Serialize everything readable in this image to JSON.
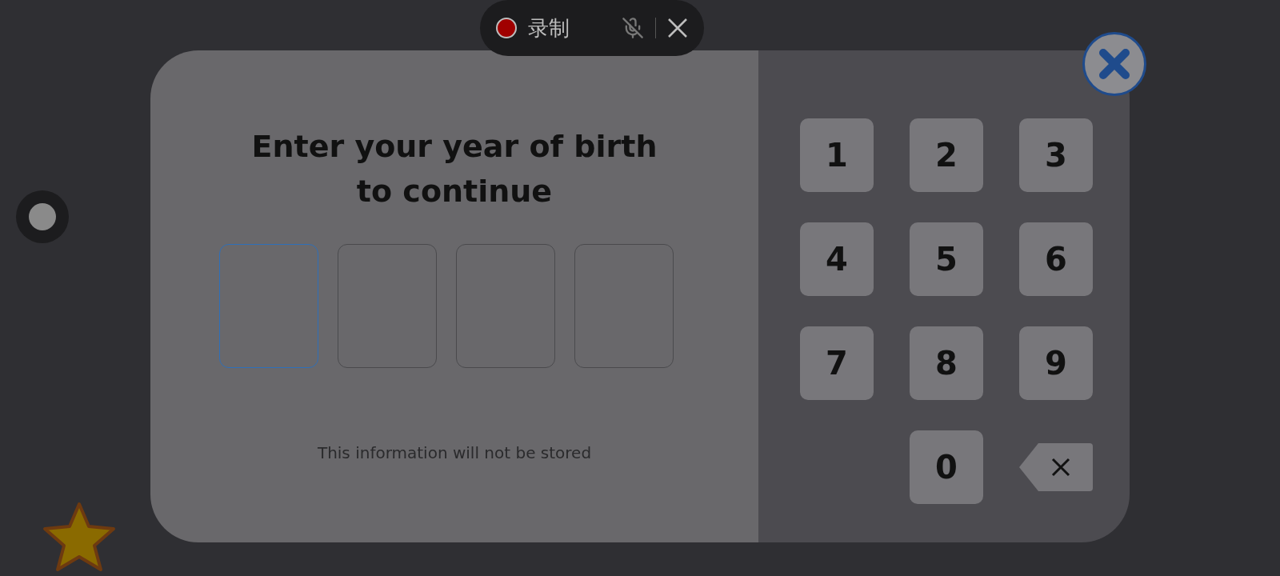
{
  "recorder": {
    "recording": true,
    "label": "录制",
    "mic_muted": true
  },
  "dialog": {
    "title": "Enter your year of birth to continue",
    "digits": [
      {
        "selected": true
      },
      {
        "selected": false
      },
      {
        "selected": false
      },
      {
        "selected": false
      }
    ],
    "note": "This information will not be stored",
    "keys": [
      {
        "kind": "digit",
        "label": "1"
      },
      {
        "kind": "digit",
        "label": "2"
      },
      {
        "kind": "digit",
        "label": "3"
      },
      {
        "kind": "digit",
        "label": "4"
      },
      {
        "kind": "digit",
        "label": "5"
      },
      {
        "kind": "digit",
        "label": "6"
      },
      {
        "kind": "digit",
        "label": "7"
      },
      {
        "kind": "digit",
        "label": "8"
      },
      {
        "kind": "digit",
        "label": "9"
      },
      {
        "kind": "blank"
      },
      {
        "kind": "digit",
        "label": "0"
      },
      {
        "kind": "backspace"
      }
    ]
  }
}
